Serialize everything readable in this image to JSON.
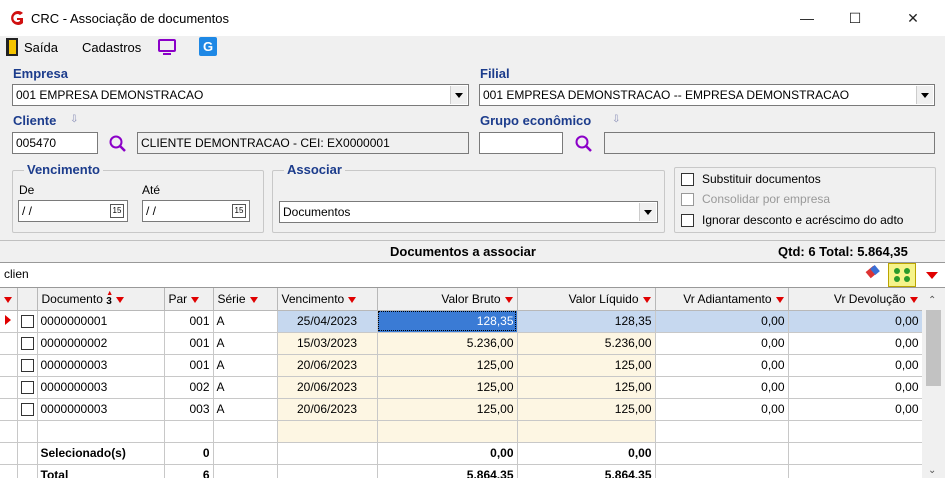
{
  "window": {
    "title": "CRC - Associação de documentos",
    "minimize": "—",
    "maximize": "☐",
    "close": "✕"
  },
  "menu": {
    "exit": "Saída",
    "registers": "Cadastros"
  },
  "empresa": {
    "label": "Empresa",
    "value": "001 EMPRESA DEMONSTRACAO"
  },
  "filial": {
    "label": "Filial",
    "value": "001 EMPRESA DEMONSTRACAO -- EMPRESA DEMONSTRACAO"
  },
  "cliente": {
    "label": "Cliente",
    "code": "005470",
    "name": "CLIENTE DEMONTRACAO - CEI: EX0000001"
  },
  "grupo": {
    "label": "Grupo econômico",
    "code": "",
    "name": ""
  },
  "vencimento": {
    "label": "Vencimento",
    "from_label": "De",
    "to_label": "Até",
    "from": " / /",
    "to": " / /"
  },
  "associar": {
    "label": "Associar",
    "value": "Documentos"
  },
  "options": {
    "substituir": "Substituir documentos",
    "consolidar": "Consolidar por empresa",
    "ignorar": "Ignorar desconto e acréscimo do adto"
  },
  "section": {
    "title": "Documentos a associar",
    "summary": "Qtd: 6 Total: 5.864,35"
  },
  "filter": {
    "value": "clien"
  },
  "columns": {
    "documento": "Documento",
    "sort_idx": "3",
    "par": "Par",
    "serie": "Série",
    "vencimento": "Vencimento",
    "bruto": "Valor Bruto",
    "liquido": "Valor Líquido",
    "adiant": "Vr Adiantamento",
    "devol": "Vr Devolução"
  },
  "rows": [
    {
      "doc": "0000000001",
      "par": "001",
      "serie": "A",
      "venc": "25/04/2023",
      "bruto": "128,35",
      "liq": "128,35",
      "adi": "0,00",
      "dev": "0,00"
    },
    {
      "doc": "0000000002",
      "par": "001",
      "serie": "A",
      "venc": "15/03/2023",
      "bruto": "5.236,00",
      "liq": "5.236,00",
      "adi": "0,00",
      "dev": "0,00"
    },
    {
      "doc": "0000000003",
      "par": "001",
      "serie": "A",
      "venc": "20/06/2023",
      "bruto": "125,00",
      "liq": "125,00",
      "adi": "0,00",
      "dev": "0,00"
    },
    {
      "doc": "0000000003",
      "par": "002",
      "serie": "A",
      "venc": "20/06/2023",
      "bruto": "125,00",
      "liq": "125,00",
      "adi": "0,00",
      "dev": "0,00"
    },
    {
      "doc": "0000000003",
      "par": "003",
      "serie": "A",
      "venc": "20/06/2023",
      "bruto": "125,00",
      "liq": "125,00",
      "adi": "0,00",
      "dev": "0,00"
    }
  ],
  "footer": {
    "sel_label": "Selecionado(s)",
    "sel_count": "0",
    "sel_bruto": "0,00",
    "sel_liq": "0,00",
    "tot_label": "Total",
    "tot_count": "6",
    "tot_bruto": "5.864,35",
    "tot_liq": "5.864,35"
  },
  "colors": {
    "accent": "#1c3c8c",
    "filter": "#e00000",
    "selection": "#3a7bd5"
  }
}
